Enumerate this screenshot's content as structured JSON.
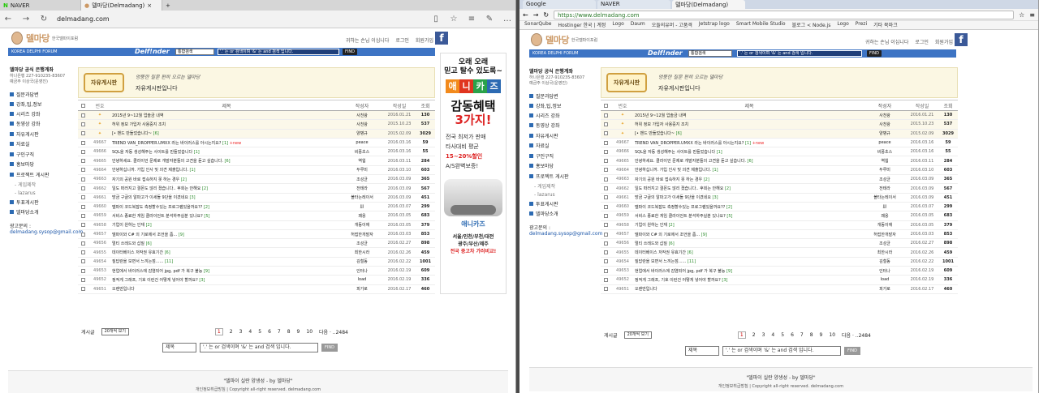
{
  "left": {
    "tabs": [
      {
        "label": "NAVER"
      },
      {
        "label": "델마당(Delmadang)"
      }
    ],
    "url": "delmadang.com"
  },
  "right": {
    "tabs": [
      {
        "label": "Google"
      },
      {
        "label": "NAVER"
      },
      {
        "label": "델마당(Delmadang)"
      }
    ],
    "url": "https://www.delmadang.com",
    "bookmarks": [
      "SonarQube",
      "Hostinger 한국 | 계정",
      "Logo",
      "Daum",
      "오들의유머 - 고품격",
      "Jetstrap logo",
      "Smart Mobile Studio",
      "블로그 < Node.js",
      "Logo",
      "Prezi",
      "기타 북마크"
    ]
  },
  "site": {
    "logo": "델마당",
    "logo_sub": "한국델파이포럼",
    "top_links": [
      "귀하는 손님 이십니다",
      "로그인",
      "회원가입"
    ],
    "facebook": "f",
    "forum_label": "KOREA DELPHI FORUM",
    "delfinder": "Delf!nder",
    "search_scope": "통합검색",
    "search_hint": "'.' 는 or 검색이며 '&' 는 and 검색 입니다.",
    "find": "FIND",
    "org_title": "델마당 공식 은행계좌",
    "account": "하나은행 227-910235-83607",
    "holder": "예금주 이상국(운영진)",
    "menu": [
      {
        "label": "질문과답변",
        "sub": false
      },
      {
        "label": "강좌,팁,정보",
        "sub": false
      },
      {
        "label": "시리즈 강좌",
        "sub": false
      },
      {
        "label": "동영상 강좌",
        "sub": false
      },
      {
        "label": "자유게시판",
        "sub": false
      },
      {
        "label": "자료실",
        "sub": false
      },
      {
        "label": "구인구직",
        "sub": false
      },
      {
        "label": "홍보마당",
        "sub": false
      },
      {
        "label": "프로젝트 게시판",
        "sub": false
      },
      {
        "label": "- 게임제작",
        "sub": true
      },
      {
        "label": "- lazarus",
        "sub": true
      },
      {
        "label": "투표게시판",
        "sub": false
      },
      {
        "label": "델마당소개",
        "sub": false
      }
    ],
    "ad_label": "광고문의 :",
    "ad_mail": "delmadang.sysop@gmail.com",
    "board_button": "자유게시판",
    "banner_quote": "엉뚱한 질문 편히 오르는 델마당",
    "banner_text": "자유게시판입니다",
    "table_headers": [
      "번호",
      "제목",
      "작성자",
      "작성일",
      "조회"
    ],
    "rows": [
      {
        "no": "",
        "title": "2015년 9~12월 업솔금 내역",
        "author": "사천왕",
        "date": "2016.01.21",
        "views": "130",
        "notice": true,
        "cmt": "",
        "new": ""
      },
      {
        "no": "",
        "title": "허위 정보 가입자 사용중지 조치",
        "author": "사천왕",
        "date": "2015.10.23",
        "views": "537",
        "notice": true,
        "cmt": "",
        "new": ""
      },
      {
        "no": "",
        "title": "[• 밴드 만들었습니다~",
        "author": "양병규",
        "date": "2015.02.09",
        "views": "3029",
        "notice": true,
        "cmt": "[6]",
        "new": ""
      },
      {
        "no": "49667",
        "title": "TREND VAN_DROPPER.UMXX 라는 바이러스를 아시는지요?",
        "author": "peace",
        "date": "2016.03.16",
        "views": "59",
        "notice": false,
        "cmt": "[1]",
        "new": "+new"
      },
      {
        "no": "49666",
        "title": "SQL을 자동 생성해주는 사이트를 만들었습니다",
        "author": "비풍초스",
        "date": "2016.03.16",
        "views": "55",
        "notice": false,
        "cmt": "[1]",
        "new": ""
      },
      {
        "no": "49665",
        "title": "안녕하세요. 클라이언 문제로 개발자분들의 고견을 듣고 싶습니다.",
        "author": "역웜",
        "date": "2016.03.11",
        "views": "284",
        "notice": false,
        "cmt": "[6]",
        "new": ""
      },
      {
        "no": "49664",
        "title": "안녕하십니까. 가입 인사 및 의견 제출입니다.",
        "author": "두루미",
        "date": "2016.03.10",
        "views": "603",
        "notice": false,
        "cmt": "[1]",
        "new": ""
      },
      {
        "no": "49663",
        "title": "자기의 공원 바로 접속하지 못 하는 경우",
        "author": "조성균",
        "date": "2016.03.09",
        "views": "365",
        "notice": false,
        "cmt": "[2]",
        "new": ""
      },
      {
        "no": "49662",
        "title": "일도 떠러지고 결몬도 않리 졌습니다.. 후회는 안해요",
        "author": "전테라",
        "date": "2016.03.09",
        "views": "567",
        "notice": false,
        "cmt": "[2]",
        "new": ""
      },
      {
        "no": "49661",
        "title": "방금 구글의 알파고가 이세돌 9단을 이겼네요",
        "author": "볼타는레이서",
        "date": "2016.03.09",
        "views": "451",
        "notice": false,
        "cmt": "[3]",
        "new": ""
      },
      {
        "no": "49660",
        "title": "델파이 코드복잡도 측정할수있는 프로그램있을까요??",
        "author": "jjj",
        "date": "2016.03.07",
        "views": "299",
        "notice": false,
        "cmt": "[2]",
        "new": ""
      },
      {
        "no": "49659",
        "title": "서비스 종료한 게임 클라이언트 분석하주실분 있나요?",
        "author": "꽤옹",
        "date": "2016.03.05",
        "views": "683",
        "notice": false,
        "cmt": "[5]",
        "new": ""
      },
      {
        "no": "49658",
        "title": "기업이 원하는 인재",
        "author": "개동이애",
        "date": "2016.03.05",
        "views": "379",
        "notice": false,
        "cmt": "[2]",
        "new": ""
      },
      {
        "no": "49657",
        "title": "델파이와 C# 의 기로에서 조언을 좀...",
        "author": "허접한개발자",
        "date": "2016.03.03",
        "views": "853",
        "notice": false,
        "cmt": "[9]",
        "new": ""
      },
      {
        "no": "49656",
        "title": "멀티 쓰레드와 삽질",
        "author": "조성균",
        "date": "2016.02.27",
        "views": "898",
        "notice": false,
        "cmt": "[6]",
        "new": ""
      },
      {
        "no": "49655",
        "title": "데이터베이스 저작권 유효기간",
        "author": "최한시라",
        "date": "2016.02.26",
        "views": "459",
        "notice": false,
        "cmt": "[6]",
        "new": ""
      },
      {
        "no": "49654",
        "title": "질답란을 보면서 느끼는점......",
        "author": "김철동",
        "date": "2016.02.22",
        "views": "1001",
        "notice": false,
        "cmt": "[11]",
        "new": ""
      },
      {
        "no": "49653",
        "title": "현업에서 바이러스에 감염되어 jpg, pdf 가 복구 불능",
        "author": "인터나",
        "date": "2016.02.19",
        "views": "609",
        "notice": false,
        "cmt": "[9]",
        "new": ""
      },
      {
        "no": "49652",
        "title": "정적게 그래프, 기호 이런건 어떻게 넣어야 할까요?",
        "author": "load",
        "date": "2016.02.19",
        "views": "336",
        "notice": false,
        "cmt": "[3]",
        "new": ""
      },
      {
        "no": "49651",
        "title": "오랜만입니다",
        "author": "피가로",
        "date": "2016.02.17",
        "views": "460",
        "notice": false,
        "cmt": "",
        "new": ""
      }
    ],
    "list_label": "게시글",
    "per_page": "20개씩 보기",
    "pages": [
      "1",
      "2",
      "3",
      "4",
      "5",
      "6",
      "7",
      "8",
      "9",
      "10"
    ],
    "page_more": "다음 · ..2484",
    "bottom_scope": "제목",
    "footer_quote": "\"델파이 실란 양생성 - by 델마당\"",
    "footer_copy": "개인정보취급방침 | Copyright all-right reserved. delmadang.com"
  },
  "ad": {
    "line1": "오래 오래",
    "line2": "믿고 탈수 있도록~",
    "brand": [
      "애",
      "니",
      "카",
      "즈"
    ],
    "brand_colors": [
      "#f28a1c",
      "#e0341f",
      "#2aa24a",
      "#2c6ab2"
    ],
    "big1": "감동혜택",
    "big2": "3가지!",
    "p1": "전국 최저가 판매",
    "p2": "타사대비 평균",
    "p3": "15~20%할인",
    "p4": "A/S완벽보증!",
    "logo": "애니카즈",
    "f1": "서울/인천/부천/대전",
    "f2": "광주/부산/제주",
    "f3": "전국 중고차 가러비교!"
  }
}
